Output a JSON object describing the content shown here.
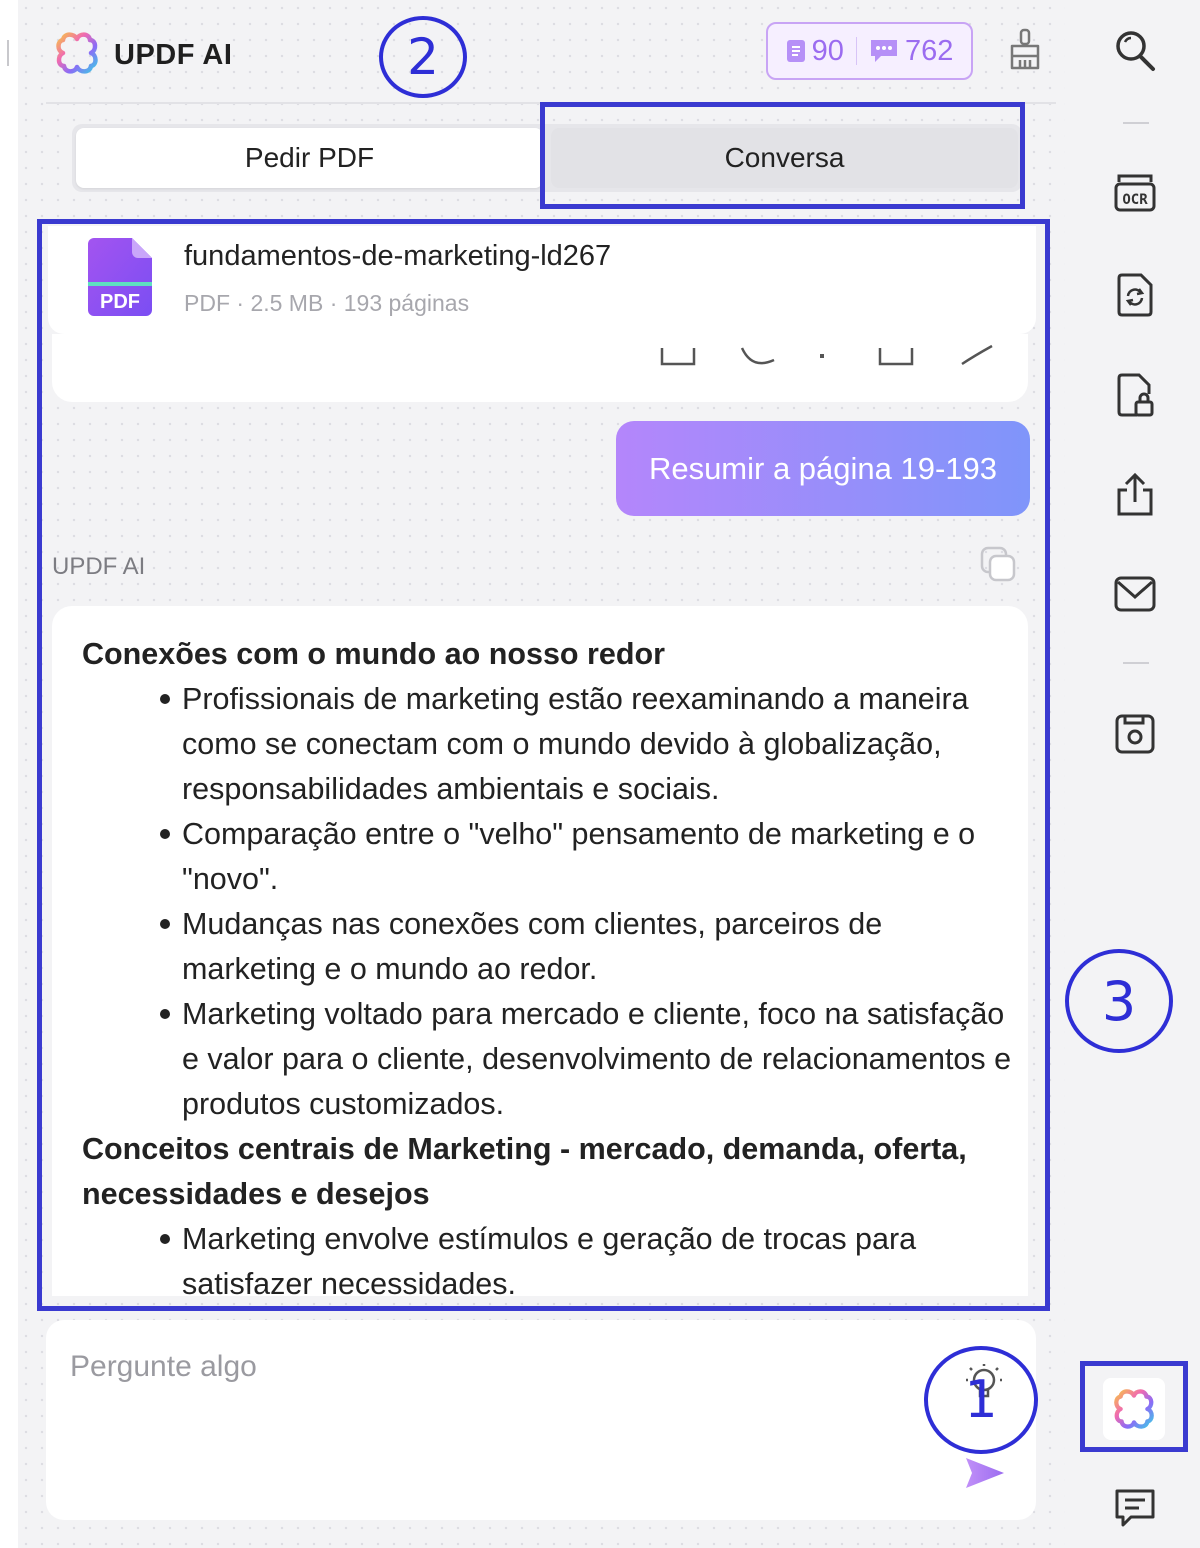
{
  "brand": {
    "name": "UPDF AI"
  },
  "quota": {
    "pages": "90",
    "messages": "762"
  },
  "tabs": [
    {
      "label": "Pedir PDF"
    },
    {
      "label": "Conversa"
    }
  ],
  "file": {
    "name": "fundamentos-de-marketing-ld267",
    "meta": "PDF · 2.5 MB · 193 páginas",
    "icon_label": "PDF"
  },
  "chat": {
    "user_message": "Resumir a página 19-193",
    "ai_label": "UPDF AI",
    "answer": {
      "sections": [
        {
          "heading": "Conexões com o mundo ao nosso redor",
          "bullets": [
            "Profissionais de marketing estão reexaminando a maneira como se conectam com o mundo devido à globalização, responsabilidades ambientais e sociais.",
            "Comparação entre o \"velho\" pensamento de marketing e o \"novo\".",
            "Mudanças nas conexões com clientes, parceiros de marketing e o mundo ao redor.",
            "Marketing voltado para mercado e cliente, foco na satisfação e valor para o cliente, desenvolvimento de relacionamentos e produtos customizados."
          ]
        },
        {
          "heading": "Conceitos centrais de Marketing - mercado, demanda, oferta, necessidades e desejos",
          "bullets": [
            "Marketing envolve estímulos e geração de trocas para satisfazer necessidades."
          ]
        }
      ]
    }
  },
  "input": {
    "placeholder": "Pergunte algo"
  },
  "annotations": {
    "a1": "1",
    "a2": "2",
    "a3": "3"
  },
  "toolbar": {
    "icons": [
      "search-icon",
      "ocr-icon",
      "convert-icon",
      "protect-icon",
      "share-icon",
      "mail-icon",
      "save-icon",
      "updf-ai-icon",
      "comment-icon"
    ],
    "ocr_label": "OCR"
  },
  "colors": {
    "accent_purple": "#9b6cf0",
    "bubble_start": "#b486fb",
    "bubble_end": "#7f95fa",
    "annotation": "#2e2ed6"
  }
}
